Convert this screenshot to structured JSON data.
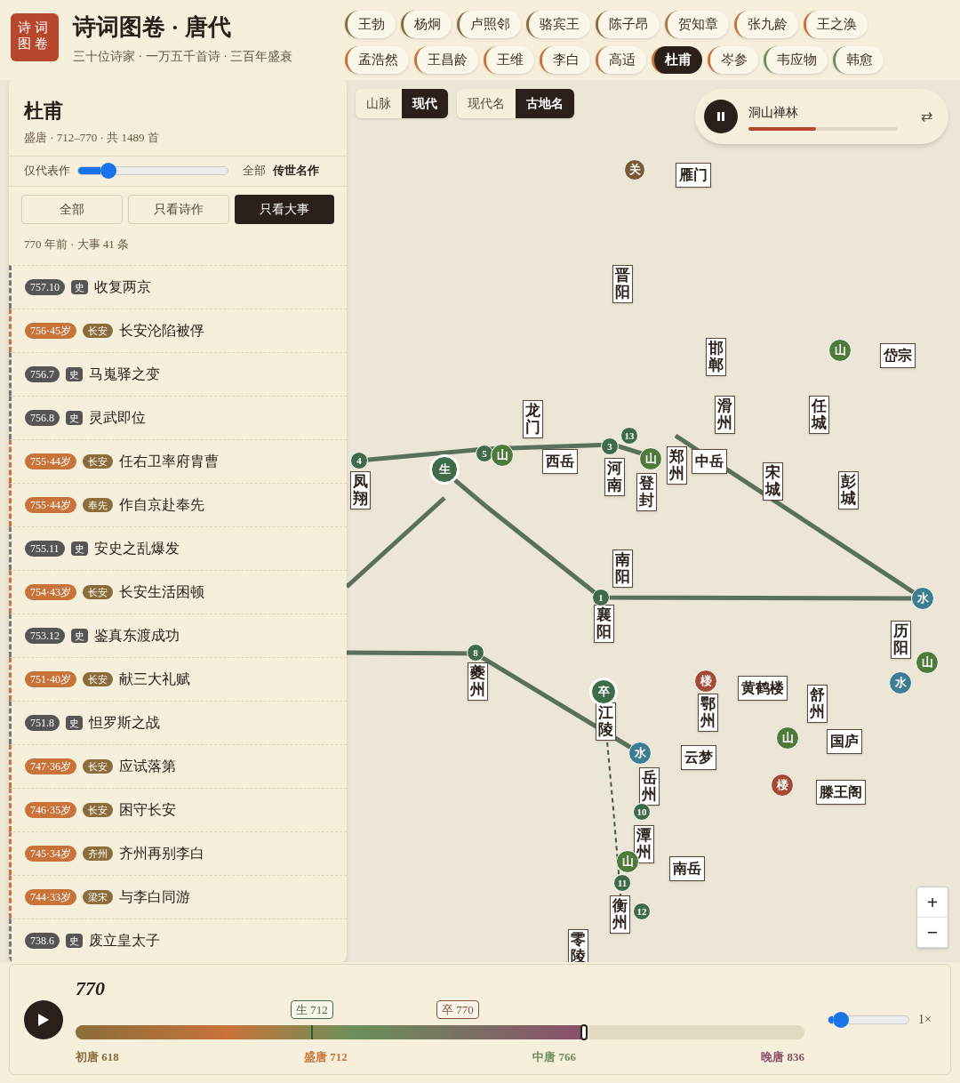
{
  "header": {
    "logo": "诗词图卷",
    "title": "诗词图卷 · 唐代",
    "subtitle": "三十位诗家 · 一万五千首诗 · 三百年盛衰"
  },
  "poets": [
    {
      "name": "王勃",
      "color": "#8a6d3b",
      "selected": false
    },
    {
      "name": "杨炯",
      "color": "#8a6d3b",
      "selected": false
    },
    {
      "name": "卢照邻",
      "color": "#8a6d3b",
      "selected": false
    },
    {
      "name": "骆宾王",
      "color": "#8a6d3b",
      "selected": false
    },
    {
      "name": "陈子昂",
      "color": "#8a6d3b",
      "selected": false
    },
    {
      "name": "贺知章",
      "color": "#b07a45",
      "selected": false
    },
    {
      "name": "张九龄",
      "color": "#c8733a",
      "selected": false
    },
    {
      "name": "王之涣",
      "color": "#c8733a",
      "selected": false
    },
    {
      "name": "孟浩然",
      "color": "#c8733a",
      "selected": false
    },
    {
      "name": "王昌龄",
      "color": "#c8733a",
      "selected": false
    },
    {
      "name": "王维",
      "color": "#c8733a",
      "selected": false
    },
    {
      "name": "李白",
      "color": "#c8733a",
      "selected": false
    },
    {
      "name": "高适",
      "color": "#c8733a",
      "selected": false
    },
    {
      "name": "杜甫",
      "color": "#c8733a",
      "selected": true
    },
    {
      "name": "岑参",
      "color": "#c8733a",
      "selected": false
    },
    {
      "name": "韦应物",
      "color": "#6b8f5a",
      "selected": false
    },
    {
      "name": "韩愈",
      "color": "#6b8f5a",
      "selected": false
    }
  ],
  "panel": {
    "poet": "杜甫",
    "meta": "盛唐 · 712–770 · 共 1489 首",
    "filter": {
      "left_label": "仅代表作",
      "level": 0.2,
      "right_label": "全部",
      "right_strong": "传世名作"
    },
    "tabs": [
      {
        "label": "全部",
        "selected": false
      },
      {
        "label": "只看诗作",
        "selected": false
      },
      {
        "label": "只看大事",
        "selected": true
      }
    ],
    "summary": "770 年前 · 大事 41 条",
    "events": [
      {
        "date": "757.10",
        "tag": "史",
        "title": "收复两京",
        "kind": "history"
      },
      {
        "date": "756·45岁",
        "tag": "长安",
        "title": "长安沦陷被俘",
        "kind": "life"
      },
      {
        "date": "756.7",
        "tag": "史",
        "title": "马嵬驿之变",
        "kind": "history"
      },
      {
        "date": "756.8",
        "tag": "史",
        "title": "灵武即位",
        "kind": "history"
      },
      {
        "date": "755·44岁",
        "tag": "长安",
        "title": "任右卫率府胄曹",
        "kind": "life"
      },
      {
        "date": "755·44岁",
        "tag": "奉先",
        "title": "作自京赴奉先",
        "kind": "life"
      },
      {
        "date": "755.11",
        "tag": "史",
        "title": "安史之乱爆发",
        "kind": "history"
      },
      {
        "date": "754·43岁",
        "tag": "长安",
        "title": "长安生活困顿",
        "kind": "life"
      },
      {
        "date": "753.12",
        "tag": "史",
        "title": "鉴真东渡成功",
        "kind": "history"
      },
      {
        "date": "751·40岁",
        "tag": "长安",
        "title": "献三大礼赋",
        "kind": "life"
      },
      {
        "date": "751.8",
        "tag": "史",
        "title": "怛罗斯之战",
        "kind": "history"
      },
      {
        "date": "747·36岁",
        "tag": "长安",
        "title": "应试落第",
        "kind": "life"
      },
      {
        "date": "746·35岁",
        "tag": "长安",
        "title": "困守长安",
        "kind": "life"
      },
      {
        "date": "745·34岁",
        "tag": "齐州",
        "title": "齐州再别李白",
        "kind": "life"
      },
      {
        "date": "744·33岁",
        "tag": "梁宋",
        "title": "与李白同游",
        "kind": "life"
      },
      {
        "date": "738.6",
        "tag": "史",
        "title": "废立皇太子",
        "kind": "history"
      }
    ]
  },
  "map": {
    "layer_toggle": [
      {
        "label": "山脉",
        "selected": false
      },
      {
        "label": "现代",
        "selected": true
      }
    ],
    "name_toggle": [
      {
        "label": "现代名",
        "selected": false
      },
      {
        "label": "古地名",
        "selected": true
      }
    ],
    "music": {
      "track": "洞山禅林",
      "playing": true,
      "level": 0.45,
      "loop": "⇄"
    },
    "labels": [
      {
        "text": "晋阳",
        "kind": "vertical"
      },
      {
        "text": "邯郸",
        "kind": "vertical"
      },
      {
        "text": "龙门",
        "kind": "vertical"
      },
      {
        "text": "滑州",
        "kind": "vertical"
      },
      {
        "text": "任城",
        "kind": "vertical"
      },
      {
        "text": "河南",
        "kind": "vertical"
      },
      {
        "text": "郑州",
        "kind": "vertical"
      },
      {
        "text": "登封",
        "kind": "vertical"
      },
      {
        "text": "西岳",
        "kind": "horizontal"
      },
      {
        "text": "中岳",
        "kind": "horizontal"
      },
      {
        "text": "凤翔",
        "kind": "vertical"
      },
      {
        "text": "南阳",
        "kind": "vertical"
      },
      {
        "text": "宋城",
        "kind": "vertical"
      },
      {
        "text": "彭城",
        "kind": "vertical"
      },
      {
        "text": "襄阳",
        "kind": "vertical"
      },
      {
        "text": "夔州",
        "kind": "vertical"
      },
      {
        "text": "江陵",
        "kind": "vertical"
      },
      {
        "text": "岳州",
        "kind": "vertical"
      },
      {
        "text": "潭州",
        "kind": "vertical"
      },
      {
        "text": "衡州",
        "kind": "vertical"
      },
      {
        "text": "零陵",
        "kind": "vertical"
      },
      {
        "text": "鄂州",
        "kind": "vertical"
      },
      {
        "text": "黄鹤楼",
        "kind": "horizontal"
      },
      {
        "text": "云梦",
        "kind": "horizontal"
      },
      {
        "text": "国庐",
        "kind": "horizontal"
      },
      {
        "text": "滕王阁",
        "kind": "horizontal"
      },
      {
        "text": "南岳",
        "kind": "horizontal"
      },
      {
        "text": "岱宗",
        "kind": "horizontal"
      },
      {
        "text": "舒州",
        "kind": "vertical"
      },
      {
        "text": "历阳",
        "kind": "vertical"
      },
      {
        "text": "雁门",
        "kind": "horizontal"
      }
    ],
    "pins": [
      {
        "text": "4",
        "kind": "number"
      },
      {
        "text": "生",
        "kind": "birth"
      },
      {
        "text": "5",
        "kind": "number"
      },
      {
        "text": "山",
        "kind": "mountain"
      },
      {
        "text": "3",
        "kind": "number"
      },
      {
        "text": "13",
        "kind": "number"
      },
      {
        "text": "山",
        "kind": "mountain"
      },
      {
        "text": "1",
        "kind": "number"
      },
      {
        "text": "8",
        "kind": "number"
      },
      {
        "text": "卒",
        "kind": "death"
      },
      {
        "text": "水",
        "kind": "water"
      },
      {
        "text": "楼",
        "kind": "tower"
      },
      {
        "text": "山",
        "kind": "mountain"
      },
      {
        "text": "楼",
        "kind": "tower"
      },
      {
        "text": "10",
        "kind": "number"
      },
      {
        "text": "山",
        "kind": "mountain"
      },
      {
        "text": "11",
        "kind": "number"
      },
      {
        "text": "12",
        "kind": "number"
      },
      {
        "text": "水",
        "kind": "water"
      },
      {
        "text": "水",
        "kind": "water"
      },
      {
        "text": "山",
        "kind": "mountain"
      },
      {
        "text": "山",
        "kind": "mountain"
      },
      {
        "text": "关",
        "kind": "pass"
      }
    ],
    "zoom": [
      "+",
      "−"
    ]
  },
  "timeline": {
    "year": "770",
    "playing": false,
    "level": 0.697,
    "birth": "生 712",
    "death": "卒 770",
    "eras": [
      {
        "label": "初唐 618",
        "color": "#8a6d3b"
      },
      {
        "label": "盛唐 712",
        "color": "#c8733a"
      },
      {
        "label": "中唐 766",
        "color": "#6b8f5a"
      },
      {
        "label": "晚唐 836",
        "color": "#8a4f6b"
      }
    ],
    "speed": {
      "level": 0.15,
      "label": "1×"
    }
  }
}
